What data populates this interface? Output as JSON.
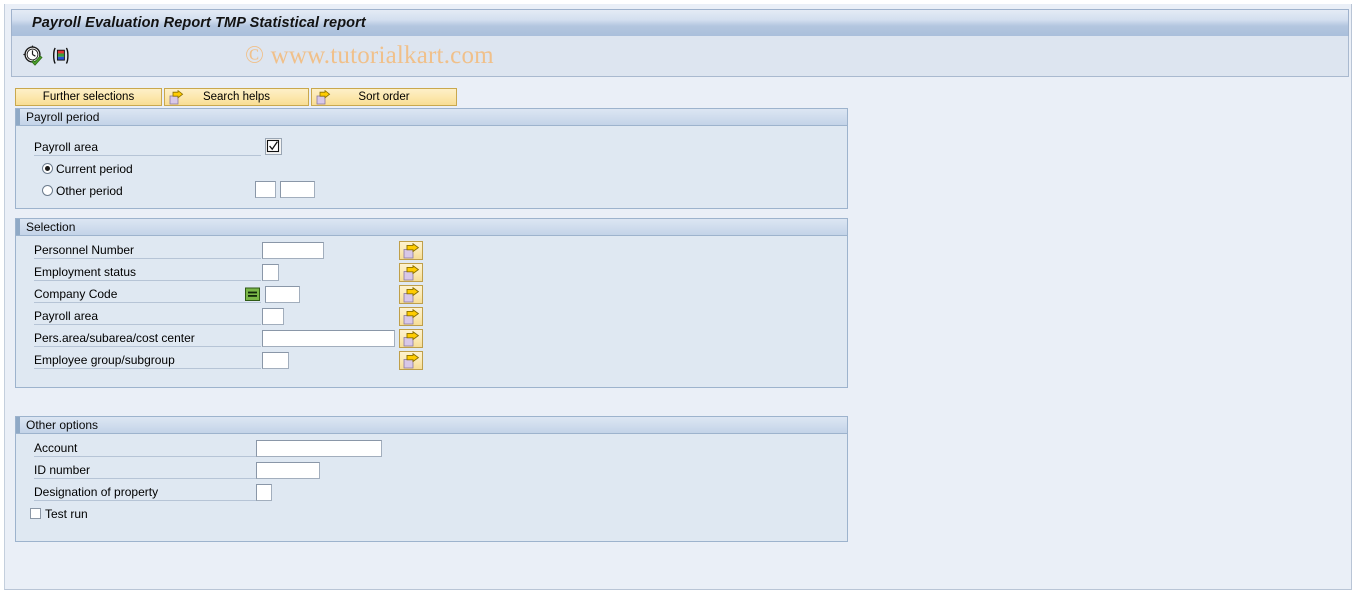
{
  "window": {
    "title": "Payroll Evaluation Report TMP Statistical report"
  },
  "toolbar": {
    "icons": [
      {
        "name": "execute-icon",
        "label": "Execute"
      },
      {
        "name": "variant-icon",
        "label": "Get variant"
      }
    ]
  },
  "watermark": "© www.tutorialkart.com",
  "buttons": [
    {
      "name": "further-selections-button",
      "label": "Further selections",
      "has_arrow": false
    },
    {
      "name": "search-helps-button",
      "label": "Search helps",
      "has_arrow": true
    },
    {
      "name": "sort-order-button",
      "label": "Sort order",
      "has_arrow": true
    }
  ],
  "payroll_period": {
    "title": "Payroll period",
    "payroll_area_label": "Payroll area",
    "payroll_area_value": "",
    "payroll_area_checked": true,
    "radio_options": [
      {
        "label": "Current period",
        "selected": true
      },
      {
        "label": "Other period",
        "selected": false
      }
    ],
    "other_period_value_1": "",
    "other_period_value_2": ""
  },
  "selection": {
    "title": "Selection",
    "rows": [
      {
        "label": "Personnel Number",
        "value": "",
        "field_width": 62,
        "has_eq_icon": false
      },
      {
        "label": "Employment status",
        "value": "",
        "field_width": 17,
        "has_eq_icon": false
      },
      {
        "label": "Company Code",
        "value": "",
        "field_width": 35,
        "has_eq_icon": true
      },
      {
        "label": "Payroll area",
        "value": "",
        "field_width": 22,
        "has_eq_icon": false
      },
      {
        "label": "Pers.area/subarea/cost center",
        "value": "",
        "field_width": 133,
        "has_eq_icon": false
      },
      {
        "label": "Employee group/subgroup",
        "value": "",
        "field_width": 27,
        "has_eq_icon": false
      }
    ],
    "multiple_selection_icon": "arrow-right-icon"
  },
  "other_options": {
    "title": "Other options",
    "rows": [
      {
        "label": "Account",
        "value": "",
        "field_width": 126
      },
      {
        "label": "ID number",
        "value": "",
        "field_width": 64
      },
      {
        "label": "Designation of property",
        "value": "",
        "field_width": 16
      }
    ],
    "test_run": {
      "label": "Test run",
      "checked": false
    }
  },
  "colors": {
    "title_bar_accent": "#aabfdb",
    "group_header": "#c3d3e8",
    "button_yellow": "#fce8ae",
    "watermark": "#f0c08a",
    "background": "#eaeff7"
  }
}
